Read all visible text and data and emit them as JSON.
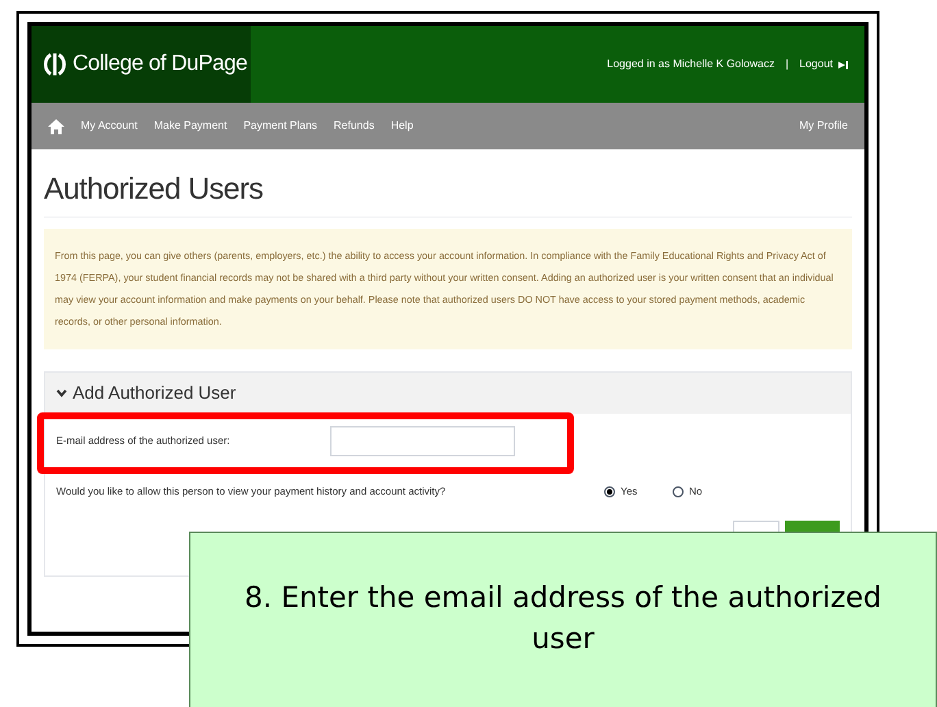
{
  "header": {
    "logo": "College of DuPage",
    "user": "Logged in as Michelle K Golowacz",
    "separator": "|",
    "logout": "Logout"
  },
  "nav": {
    "items": [
      "My Account",
      "Make Payment",
      "Payment Plans",
      "Refunds",
      "Help"
    ],
    "profile": "My Profile"
  },
  "page_title": "Authorized Users",
  "notice": "From this page, you can give others (parents, employers, etc.) the ability to access your account information. In compliance with the Family Educational Rights and Privacy Act of 1974 (FERPA), your student financial records may not be shared with a third party without your written consent. Adding an authorized user is your written consent that an individual may view your account information and make payments on your behalf. Please note that authorized users DO NOT have access to your stored payment methods, academic records, or other personal information.",
  "section": {
    "title": "Add Authorized User",
    "expanded": true,
    "email_label": "E-mail address of the authorized user:",
    "question": "Would you like to allow this person to view your payment history and account activity?",
    "options": [
      {
        "label": "Yes",
        "selected": true
      },
      {
        "label": "No",
        "selected": false
      }
    ]
  },
  "callout": "8. Enter the email address of the authorized user"
}
